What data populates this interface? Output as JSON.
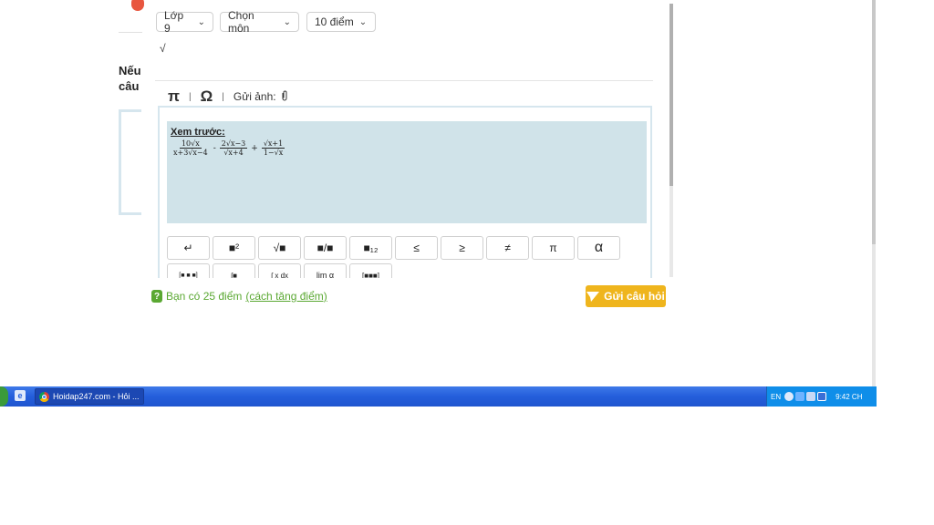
{
  "modal": {
    "grade_select": "Lớp 9",
    "subject_select": "Chọn môn",
    "points_select": "10 điểm",
    "editor_text": "√",
    "toolbar": {
      "pi_symbol": "π",
      "separator": "|",
      "omega_symbol": "Ω",
      "upload_label": "Gửi ảnh:"
    },
    "preview": {
      "label": "Xem trước:",
      "formula": {
        "f1_num": "10√x",
        "f1_den": "x+3√x−4",
        "op1": "-",
        "f2_num": "2√x−3",
        "f2_den": "√x+4",
        "op2": "+",
        "f3_num": "√x+1",
        "f3_den": "1−√x"
      }
    },
    "keys_row1": [
      "↵",
      "■²",
      "√■",
      "■/■",
      "■₁₂",
      "≤",
      "≥",
      "≠",
      "π",
      "α"
    ],
    "keys_row2": [
      "[■ ■ ■]",
      "∫■",
      "∫ x dx",
      "lim α",
      "[■■■]"
    ]
  },
  "footer": {
    "points_text": "Bạn có 25 điểm",
    "points_link": "(cách tăng điểm)",
    "submit_label": "Gửi câu hỏi"
  },
  "background": {
    "partial_text_1": "Nếu",
    "partial_text_2": "câu"
  },
  "taskbar": {
    "task_title": "Hoidap247.com - Hỏi ...",
    "lang": "EN",
    "clock": "9:42 CH"
  },
  "colors": {
    "accent_green": "#5aa832",
    "submit_yellow": "#efb51d",
    "preview_bg": "#d0e3e9",
    "taskbar_blue": "#245edb"
  }
}
